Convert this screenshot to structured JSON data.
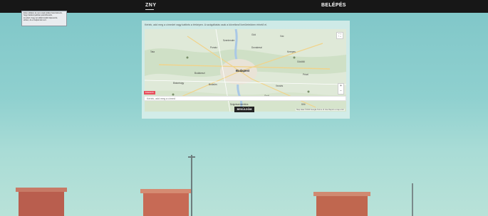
{
  "header": {
    "logo_text": "ZNY",
    "login_label": "BELÉPÉS"
  },
  "cookie_notice": {
    "lines": [
      "Ezen oldalon és nem csak sütiket használnunk,",
      "hogy hatékonyabban jeleníthessük,",
      "és azért, hogy az oldalt tovább fejlesszük,",
      "ebben, de el tudjuk látni ezt."
    ]
  },
  "panel": {
    "intro_text": "Kérlek, add meg a címedet vagy kattints a térképen. A szolgáltatás csak a következő kerületekben érhető el.",
    "required_badge": "Kötelező",
    "address_placeholder": "Kérlek, add meg a címed",
    "submit_label": "BEKÜLDÖM"
  },
  "map": {
    "city": "Budapest",
    "labels": [
      "Szentendre",
      "Göd",
      "Vác",
      "Budakeszi",
      "Budaörs",
      "Érd",
      "Gödöllő",
      "Vecsés",
      "Gyál",
      "Dunakeszi",
      "Szigetszentmiklós",
      "Pomáz",
      "Biatorbágy",
      "Tata",
      "Kerepes",
      "Pécel",
      "Monor",
      "Üllő"
    ],
    "credit": "Map data ©2023 Google  Terms of Use  Report a map error"
  }
}
